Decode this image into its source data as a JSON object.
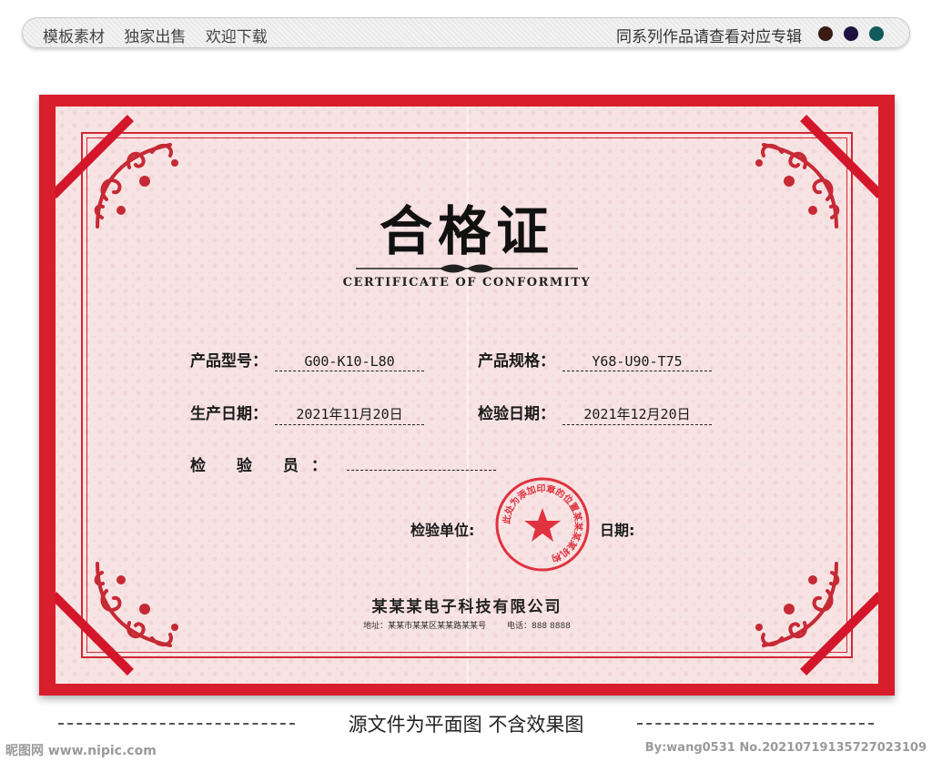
{
  "banner": {
    "left_items": [
      "模板素材",
      "独家出售",
      "欢迎下载"
    ],
    "right_text": "同系列作品请查看对应专辑",
    "swatches": [
      "#3a1a12",
      "#1e1240",
      "#0f5a5a"
    ]
  },
  "certificate": {
    "title": "合格证",
    "subtitle": "CERTIFICATE OF CONFORMITY",
    "fields": {
      "model_label": "产品型号：",
      "model_value": "G00-K10-L80",
      "spec_label": "产品规格：",
      "spec_value": "Y68-U90-T75",
      "prod_date_label": "生产日期：",
      "prod_date_value": "2021年11月20日",
      "insp_date_label": "检验日期：",
      "insp_date_value": "2021年12月20日",
      "inspector_label": "检 验 员：",
      "inspector_value": ""
    },
    "unit_label": "检验单位:",
    "date_label": "日期:",
    "seal_text": "此处为添加印章的位置某某某某机构",
    "company": "某某某电子科技有限公司",
    "address": "地址：某某市某某区某某路某某号",
    "phone": "电话：888 8888",
    "colors": {
      "frame": "#d81d2c",
      "paper": "#f7e3e3",
      "seal": "#e0323f"
    }
  },
  "footer": {
    "note": "源文件为平面图 不含效果图",
    "watermark_left": "昵图网 www.nipic.com",
    "watermark_right": "By:wang0531 No.20210719135727023109"
  }
}
